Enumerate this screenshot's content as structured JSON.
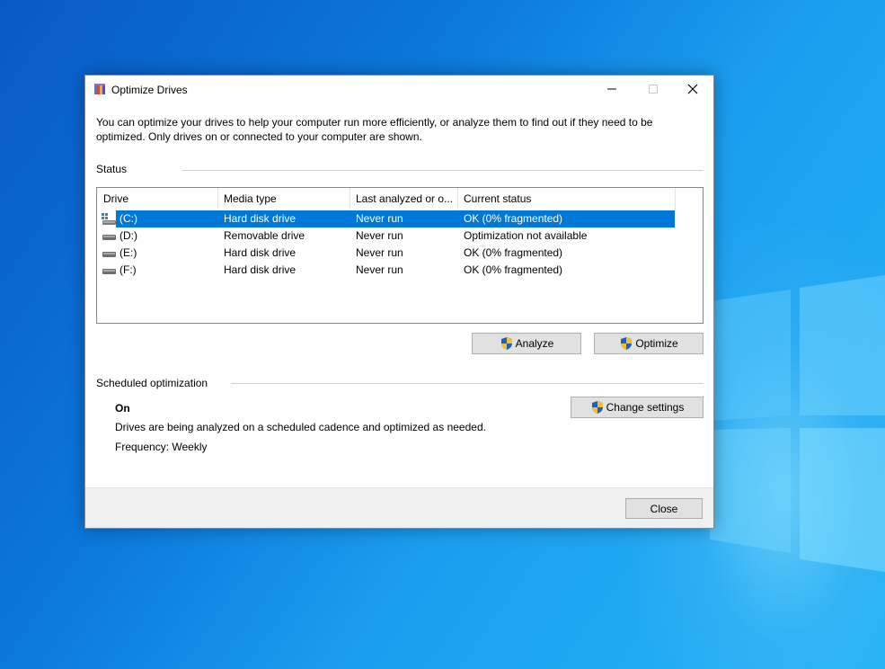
{
  "window": {
    "title": "Optimize Drives",
    "icon": "defrag-app-icon"
  },
  "titlebar_buttons": {
    "minimize": "minimize-icon",
    "maximize": "maximize-icon",
    "close": "close-icon"
  },
  "intro_text": "You can optimize your drives to help your computer run more efficiently, or analyze them to find out if they need to be optimized. Only drives on or connected to your computer are shown.",
  "status": {
    "label": "Status",
    "columns": [
      "Drive",
      "Media type",
      "Last analyzed or o...",
      "Current status"
    ],
    "rows": [
      {
        "drive": "(C:)",
        "media": "Hard disk drive",
        "last": "Never run",
        "status": "OK (0% fragmented)",
        "icon": "windows-drive-icon",
        "selected": true
      },
      {
        "drive": "(D:)",
        "media": "Removable drive",
        "last": "Never run",
        "status": "Optimization not available",
        "icon": "drive-icon",
        "selected": false
      },
      {
        "drive": "(E:)",
        "media": "Hard disk drive",
        "last": "Never run",
        "status": "OK (0% fragmented)",
        "icon": "drive-icon",
        "selected": false
      },
      {
        "drive": "(F:)",
        "media": "Hard disk drive",
        "last": "Never run",
        "status": "OK (0% fragmented)",
        "icon": "drive-icon",
        "selected": false
      }
    ]
  },
  "buttons": {
    "analyze": "Analyze",
    "optimize": "Optimize",
    "change_settings": "Change settings",
    "close": "Close"
  },
  "scheduled": {
    "label": "Scheduled optimization",
    "state": "On",
    "description": "Drives are being analyzed on a scheduled cadence and optimized as needed.",
    "frequency": "Frequency: Weekly"
  },
  "colors": {
    "selection": "#0078d7",
    "button_face": "#e1e1e1",
    "footer": "#f0f0f0"
  }
}
